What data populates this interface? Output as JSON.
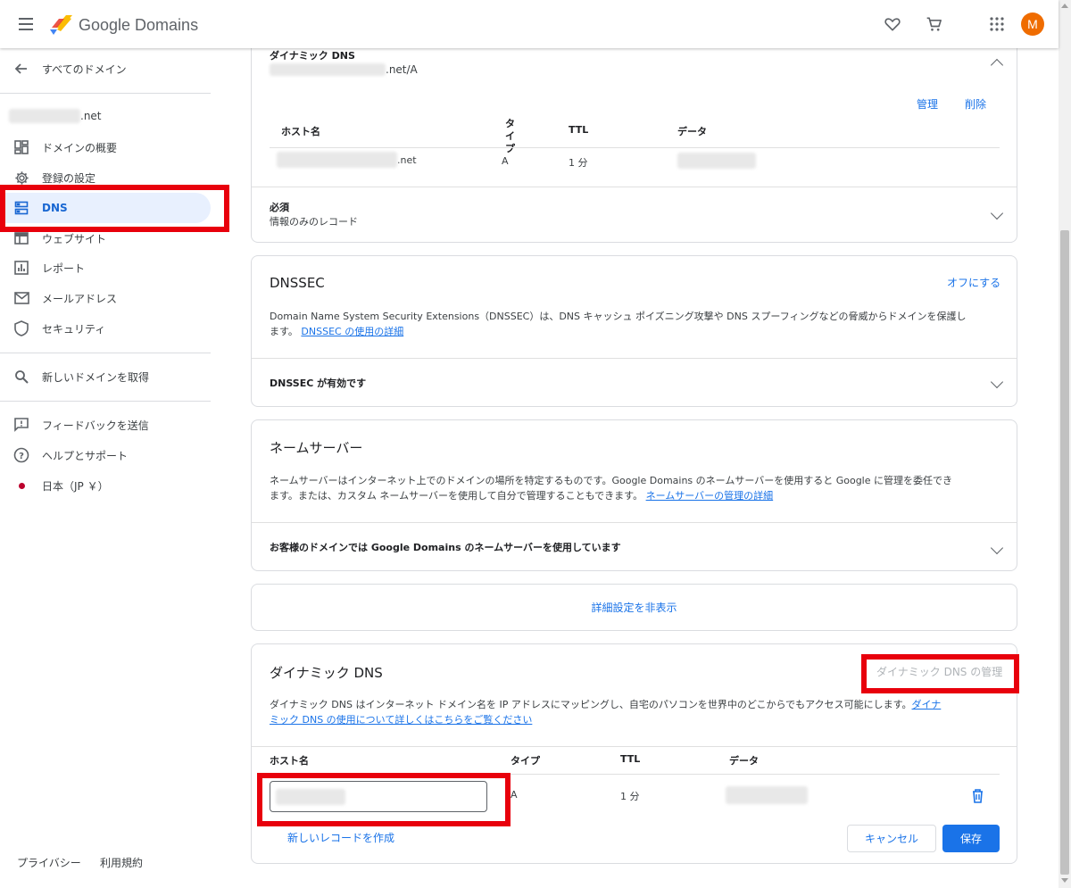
{
  "header": {
    "brand": "Google Domains",
    "avatar_letter": "M",
    "icons": [
      "menu-icon",
      "favorite-icon",
      "cart-icon",
      "apps-icon"
    ]
  },
  "sidebar": {
    "back_label": "すべてのドメイン",
    "domain_suffix": ".net",
    "items": [
      {
        "label": "ドメインの概要",
        "icon": "dashboard-icon"
      },
      {
        "label": "登録の設定",
        "icon": "gear-icon"
      },
      {
        "label": "DNS",
        "icon": "dns-icon",
        "active": true
      },
      {
        "label": "ウェブサイト",
        "icon": "web-icon"
      },
      {
        "label": "レポート",
        "icon": "report-icon"
      },
      {
        "label": "メールアドレス",
        "icon": "mail-icon"
      },
      {
        "label": "セキュリティ",
        "icon": "shield-icon"
      }
    ],
    "get_domain_label": "新しいドメインを取得",
    "feedback_label": "フィードバックを送信",
    "help_label": "ヘルプとサポート",
    "locale_label": "日本（JP ￥）",
    "privacy_label": "プライバシー",
    "terms_label": "利用規約"
  },
  "top_card": {
    "title": "ダイナミック DNS",
    "record_suffix": ".net/A",
    "manage_link": "管理",
    "delete_link": "削除",
    "columns": [
      "ホスト名",
      "タイプ",
      "TTL",
      "データ"
    ],
    "row": {
      "host_suffix": ".net",
      "type": "A",
      "ttl": "1 分"
    },
    "required_title": "必須",
    "required_sub": "情報のみのレコード"
  },
  "dnssec": {
    "title": "DNSSEC",
    "toggle_link": "オフにする",
    "description": "Domain Name System Security Extensions（DNSSEC）は、DNS キャッシュ ポイズニング攻撃や DNS スプーフィングなどの脅威からドメインを保護し",
    "description2": "ます。",
    "learn_more": "DNSSEC の使用の詳細",
    "status": "DNSSEC が有効です"
  },
  "nameservers": {
    "title": "ネームサーバー",
    "description": "ネームサーバーはインターネット上でのドメインの場所を特定するものです。Google Domains のネームサーバーを使用すると Google に管理を委任でき",
    "description2": "ます。または、カスタム ネームサーバーを使用して自分で管理することもできます。",
    "learn_more": "ネームサーバーの管理の詳細",
    "status": "お客様のドメインでは Google Domains のネームサーバーを使用しています"
  },
  "advanced": {
    "hide_label": "詳細設定を非表示"
  },
  "ddns": {
    "title": "ダイナミック DNS",
    "manage_link": "ダイナミック DNS の管理",
    "description": "ダイナミック DNS はインターネット ドメイン名を IP アドレスにマッピングし、自宅のパソコンを世界中のどこからでもアクセス可能にします。",
    "learn_more_1": "ダイナ",
    "learn_more_2": "ミック DNS の使用について詳しくはこちらをご覧ください",
    "columns": [
      "ホスト名",
      "タイプ",
      "TTL",
      "データ"
    ],
    "row": {
      "type": "A",
      "ttl": "1 分"
    },
    "new_record_link": "新しいレコードを作成",
    "cancel_label": "キャンセル",
    "save_label": "保存"
  }
}
